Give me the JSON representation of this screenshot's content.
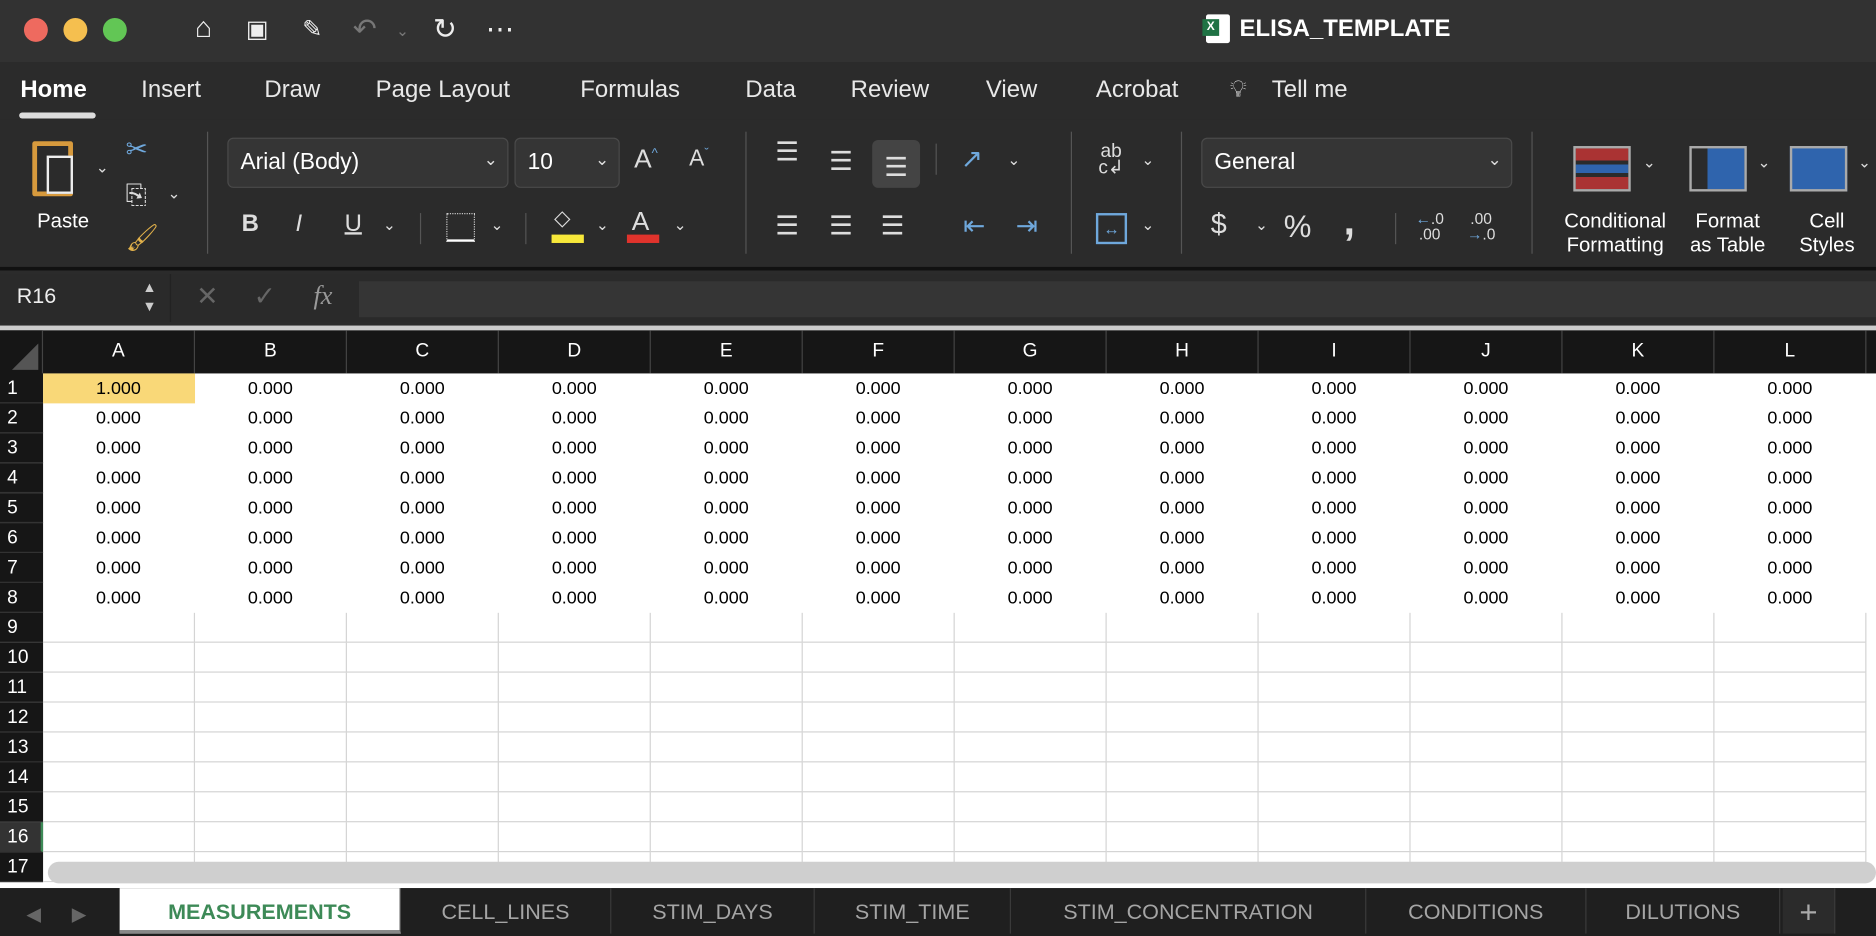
{
  "window": {
    "title": "ELISA_TEMPLATE"
  },
  "quick_access": [
    "home-icon",
    "save-icon",
    "save-as-icon",
    "undo-icon",
    "redo-icon",
    "more-icon"
  ],
  "tabs": [
    "Home",
    "Insert",
    "Draw",
    "Page Layout",
    "Formulas",
    "Data",
    "Review",
    "View",
    "Acrobat"
  ],
  "tell_me": "Tell me",
  "ribbon": {
    "paste": "Paste",
    "font": "Arial (Body)",
    "size": "10",
    "number_format": "General",
    "conditional": [
      "Conditional",
      "Formatting"
    ],
    "format_table": [
      "Format",
      "as Table"
    ],
    "cell_styles": [
      "Cell",
      "Styles"
    ],
    "bold": "B",
    "italic": "I",
    "underline": "U",
    "currency": "$",
    "percent": "%",
    "comma": ",",
    "fill_color": "#f7e83a",
    "font_color_swatch": "#e0332c"
  },
  "formula_bar": {
    "name_box": "R16",
    "fx": "fx",
    "value": ""
  },
  "columns": [
    "A",
    "B",
    "C",
    "D",
    "E",
    "F",
    "G",
    "H",
    "I",
    "J",
    "K",
    "L"
  ],
  "row_numbers": [
    "1",
    "2",
    "3",
    "4",
    "5",
    "6",
    "7",
    "8",
    "9",
    "10",
    "11",
    "12",
    "13",
    "14",
    "15",
    "16",
    "17"
  ],
  "grid": [
    [
      "1.000",
      "0.000",
      "0.000",
      "0.000",
      "0.000",
      "0.000",
      "0.000",
      "0.000",
      "0.000",
      "0.000",
      "0.000",
      "0.000"
    ],
    [
      "0.000",
      "0.000",
      "0.000",
      "0.000",
      "0.000",
      "0.000",
      "0.000",
      "0.000",
      "0.000",
      "0.000",
      "0.000",
      "0.000"
    ],
    [
      "0.000",
      "0.000",
      "0.000",
      "0.000",
      "0.000",
      "0.000",
      "0.000",
      "0.000",
      "0.000",
      "0.000",
      "0.000",
      "0.000"
    ],
    [
      "0.000",
      "0.000",
      "0.000",
      "0.000",
      "0.000",
      "0.000",
      "0.000",
      "0.000",
      "0.000",
      "0.000",
      "0.000",
      "0.000"
    ],
    [
      "0.000",
      "0.000",
      "0.000",
      "0.000",
      "0.000",
      "0.000",
      "0.000",
      "0.000",
      "0.000",
      "0.000",
      "0.000",
      "0.000"
    ],
    [
      "0.000",
      "0.000",
      "0.000",
      "0.000",
      "0.000",
      "0.000",
      "0.000",
      "0.000",
      "0.000",
      "0.000",
      "0.000",
      "0.000"
    ],
    [
      "0.000",
      "0.000",
      "0.000",
      "0.000",
      "0.000",
      "0.000",
      "0.000",
      "0.000",
      "0.000",
      "0.000",
      "0.000",
      "0.000"
    ],
    [
      "0.000",
      "0.000",
      "0.000",
      "0.000",
      "0.000",
      "0.000",
      "0.000",
      "0.000",
      "0.000",
      "0.000",
      "0.000",
      "0.000"
    ]
  ],
  "highlight_cell_color": "#f9d878",
  "sheets": [
    "MEASUREMENTS",
    "CELL_LINES",
    "STIM_DAYS",
    "STIM_TIME",
    "STIM_CONCENTRATION",
    "CONDITIONS",
    "DILUTIONS"
  ],
  "add_sheet": "+"
}
